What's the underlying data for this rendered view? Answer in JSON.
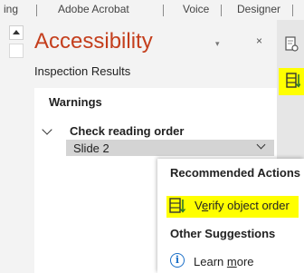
{
  "ribbon": {
    "tabs": [
      "ing",
      "Adobe Acrobat",
      "Voice",
      "Designer"
    ]
  },
  "pane": {
    "title": "Accessibility",
    "menu_glyph": "▾",
    "close_glyph": "×",
    "subtitle": "Inspection Results",
    "warnings_heading": "Warnings",
    "issue": "Check reading order",
    "issue_item": "Slide 2"
  },
  "popup": {
    "recommended_heading": "Recommended Actions",
    "verify_pre": "V",
    "verify_underline": "e",
    "verify_post": "rify object order",
    "other_heading": "Other Suggestions",
    "info_glyph": "i",
    "learn_pre": "Learn ",
    "learn_underline": "m",
    "learn_post": "ore"
  },
  "colors": {
    "title": "#c43e1c",
    "highlight": "#ffff00",
    "info": "#1a6fc7"
  },
  "icons": [
    "scroll-up-icon",
    "pane-options-icon",
    "close-icon",
    "chevron-down-icon",
    "reading-order-icon",
    "verify-order-icon",
    "info-icon"
  ]
}
